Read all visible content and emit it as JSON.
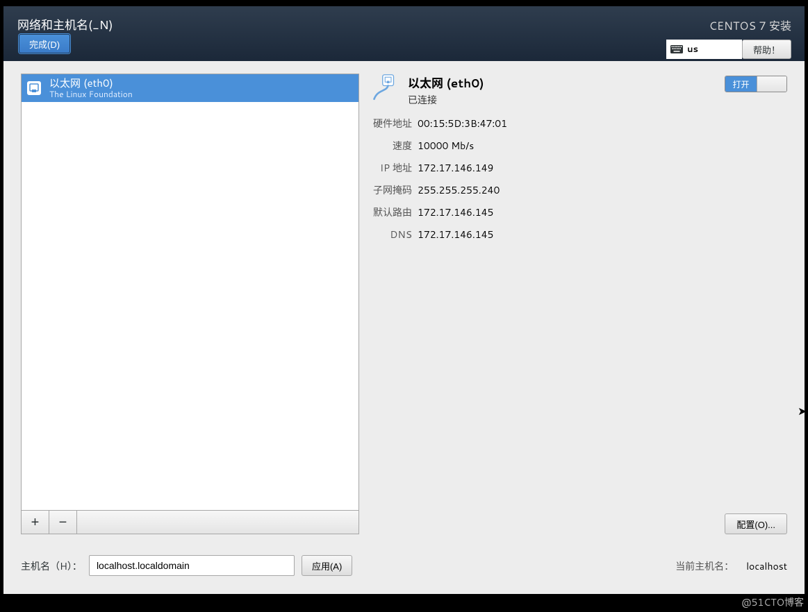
{
  "header": {
    "title": "网络和主机名(_N)",
    "done_label": "完成(D)",
    "installer_name": "CENTOS 7 安装",
    "lang_code": "us",
    "help_label": "帮助！"
  },
  "sidebar": {
    "items": [
      {
        "name": "以太网 (eth0)",
        "subtitle": "The Linux Foundation"
      }
    ],
    "add_label": "+",
    "remove_label": "−"
  },
  "detail": {
    "title": "以太网 (eth0)",
    "status": "已连接",
    "toggle_on_label": "打开",
    "rows": [
      {
        "key": "硬件地址",
        "value": "00:15:5D:3B:47:01"
      },
      {
        "key": "速度",
        "value": "10000 Mb/s"
      },
      {
        "key": "IP 地址",
        "value": "172.17.146.149"
      },
      {
        "key": "子网掩码",
        "value": "255.255.255.240"
      },
      {
        "key": "默认路由",
        "value": "172.17.146.145"
      },
      {
        "key": "DNS",
        "value": "172.17.146.145"
      }
    ],
    "config_label": "配置(O)..."
  },
  "footer": {
    "hostname_label": "主机名（H）：",
    "hostname_value": "localhost.localdomain",
    "apply_label": "应用(A)",
    "current_hostname_label": "当前主机名：",
    "current_hostname_value": "localhost"
  },
  "watermark": "@51CTO博客"
}
